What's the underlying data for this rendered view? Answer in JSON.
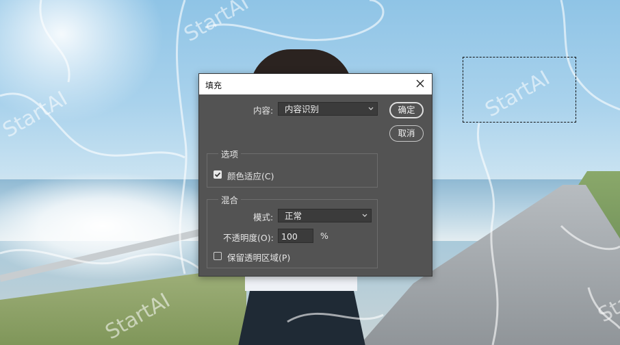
{
  "background": {
    "watermark_text": "StartAI"
  },
  "dialog": {
    "title": "填充",
    "contents_label": "内容:",
    "contents_value": "内容识别",
    "ok_label": "确定",
    "cancel_label": "取消",
    "options_group": {
      "legend": "选项",
      "color_adapt_label": "颜色适应(C)",
      "color_adapt_checked": true
    },
    "blend_group": {
      "legend": "混合",
      "mode_label": "模式:",
      "mode_value": "正常",
      "opacity_label": "不透明度(O):",
      "opacity_value": "100",
      "opacity_unit": "%",
      "preserve_label": "保留透明区域(P)",
      "preserve_checked": false
    }
  },
  "colors": {
    "dialog_bg": "#535353",
    "field_bg": "#3b3b3b",
    "text": "#e6e6e6"
  }
}
